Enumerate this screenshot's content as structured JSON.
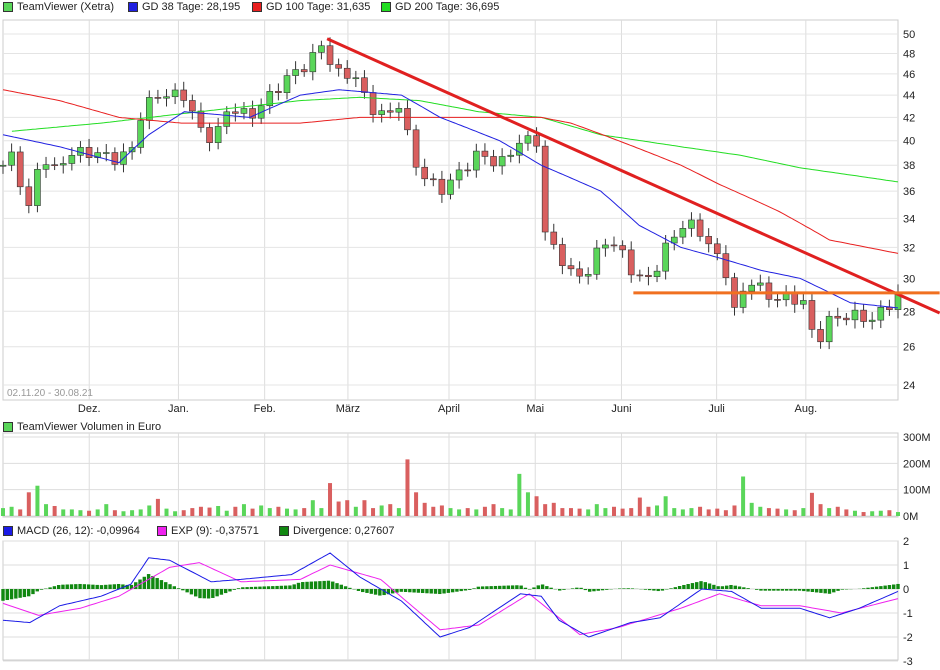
{
  "legend": {
    "title": "TeamViewer (Xetra)",
    "gd38": "GD 38 Tage: 28,195",
    "gd100": "GD 100 Tage: 31,635",
    "gd200": "GD 200 Tage: 36,695",
    "range": "02.11.20 - 30.08.21",
    "volume": "TeamViewer Volumen in Euro",
    "macd": "MACD (26, 12): -0,09964",
    "exp": "EXP (9): -0,37571",
    "div": "Divergence: 0,27607"
  },
  "colors": {
    "up": "#5ad65a",
    "down": "#d95f5f",
    "gd38": "#2020e0",
    "gd100": "#e82020",
    "gd200": "#22dd22",
    "trend": "#e02020",
    "support": "#f07020",
    "macd": "#1a1ae6",
    "exp": "#ee22ee",
    "div": "#118811"
  },
  "chart_data": [
    {
      "type": "candlestick",
      "title": "TeamViewer (Xetra)",
      "scale": "log",
      "ylim": [
        23,
        51
      ],
      "yticks": [
        "24",
        "26",
        "28",
        "30",
        "32",
        "34",
        "36",
        "38",
        "40",
        "42",
        "44",
        "46",
        "48",
        "50"
      ],
      "months": [
        {
          "label": "Dez.",
          "day": 29
        },
        {
          "label": "Jan.",
          "day": 59
        },
        {
          "label": "Feb.",
          "day": 88
        },
        {
          "label": "März",
          "day": 116
        },
        {
          "label": "April",
          "day": 150
        },
        {
          "label": "Mai",
          "day": 179
        },
        {
          "label": "Juni",
          "day": 208
        },
        {
          "label": "Juli",
          "day": 240
        },
        {
          "label": "Aug.",
          "day": 270
        }
      ],
      "days_total": 301,
      "close": [
        [
          0,
          38
        ],
        [
          4,
          39
        ],
        [
          8,
          34
        ],
        [
          13,
          39
        ],
        [
          17,
          37.5
        ],
        [
          23,
          39
        ],
        [
          31,
          39
        ],
        [
          38,
          38.5
        ],
        [
          43,
          39
        ],
        [
          46,
          42
        ],
        [
          51,
          44
        ],
        [
          61,
          44
        ],
        [
          66,
          41
        ],
        [
          71,
          40
        ],
        [
          76,
          43
        ],
        [
          83,
          42
        ],
        [
          90,
          44
        ],
        [
          97,
          46
        ],
        [
          103,
          47
        ],
        [
          107,
          49
        ],
        [
          112,
          46
        ],
        [
          118,
          46
        ],
        [
          123,
          43
        ],
        [
          129,
          42
        ],
        [
          134,
          43.5
        ],
        [
          137,
          39
        ],
        [
          140,
          37.5
        ],
        [
          147,
          36
        ],
        [
          154,
          37.5
        ],
        [
          160,
          39
        ],
        [
          167,
          38
        ],
        [
          174,
          40
        ],
        [
          180,
          40
        ],
        [
          182,
          33
        ],
        [
          187,
          31.5
        ],
        [
          192,
          30
        ],
        [
          197,
          30.5
        ],
        [
          202,
          32.5
        ],
        [
          207,
          32
        ],
        [
          213,
          30
        ],
        [
          218,
          30
        ],
        [
          223,
          32
        ],
        [
          228,
          33.5
        ],
        [
          233,
          33.5
        ],
        [
          238,
          32
        ],
        [
          243,
          30.5
        ],
        [
          246,
          28
        ],
        [
          251,
          30
        ],
        [
          258,
          28.8
        ],
        [
          265,
          28.8
        ],
        [
          270,
          28.5
        ],
        [
          273,
          26
        ],
        [
          278,
          27.5
        ],
        [
          285,
          27.8
        ],
        [
          292,
          27.5
        ],
        [
          297,
          28.2
        ],
        [
          301,
          29
        ]
      ],
      "gd38": [
        [
          0,
          40.5
        ],
        [
          19,
          39.5
        ],
        [
          39,
          38.2
        ],
        [
          49,
          40.5
        ],
        [
          61,
          42.5
        ],
        [
          83,
          42
        ],
        [
          100,
          44
        ],
        [
          113,
          44.5
        ],
        [
          134,
          44
        ],
        [
          147,
          42
        ],
        [
          167,
          40
        ],
        [
          181,
          38
        ],
        [
          201,
          36
        ],
        [
          214,
          33.5
        ],
        [
          228,
          32
        ],
        [
          241,
          31.3
        ],
        [
          255,
          30.5
        ],
        [
          268,
          30
        ],
        [
          285,
          28.5
        ],
        [
          301,
          28.2
        ]
      ],
      "gd100": [
        [
          0,
          44.5
        ],
        [
          19,
          43.5
        ],
        [
          39,
          42
        ],
        [
          60,
          41.5
        ],
        [
          83,
          41.5
        ],
        [
          100,
          41.5
        ],
        [
          120,
          42
        ],
        [
          140,
          42
        ],
        [
          160,
          42
        ],
        [
          181,
          42
        ],
        [
          191,
          41.5
        ],
        [
          207,
          40
        ],
        [
          228,
          38
        ],
        [
          241,
          36.5
        ],
        [
          261,
          34.5
        ],
        [
          278,
          32.5
        ],
        [
          301,
          31.6
        ]
      ],
      "gd200": [
        [
          3,
          40.8
        ],
        [
          33,
          41.5
        ],
        [
          66,
          42.5
        ],
        [
          100,
          43.5
        ],
        [
          120,
          43.8
        ],
        [
          140,
          43.5
        ],
        [
          160,
          42.5
        ],
        [
          181,
          42
        ],
        [
          201,
          40.5
        ],
        [
          228,
          39.5
        ],
        [
          248,
          38.8
        ],
        [
          268,
          37.8
        ],
        [
          301,
          36.7
        ]
      ],
      "trendline": [
        [
          109,
          49.5
        ],
        [
          315,
          27.9
        ]
      ],
      "support": [
        [
          212,
          29.1
        ],
        [
          315,
          29.1
        ]
      ]
    },
    {
      "type": "bar",
      "title": "TeamViewer Volumen in Euro",
      "ylim": [
        0,
        300
      ],
      "yticks": [
        "0M",
        "100M",
        "200M",
        "300M"
      ],
      "values": [
        30,
        35,
        25,
        90,
        115,
        45,
        38,
        25,
        25,
        22,
        20,
        25,
        45,
        22,
        18,
        22,
        25,
        40,
        65,
        28,
        18,
        22,
        30,
        35,
        32,
        38,
        20,
        35,
        45,
        28,
        40,
        30,
        35,
        28,
        25,
        30,
        60,
        30,
        125,
        55,
        60,
        35,
        60,
        30,
        40,
        45,
        30,
        215,
        90,
        50,
        35,
        40,
        30,
        25,
        30,
        25,
        35,
        45,
        30,
        25,
        160,
        90,
        75,
        45,
        50,
        30,
        30,
        28,
        25,
        45,
        30,
        35,
        28,
        30,
        70,
        35,
        40,
        75,
        30,
        25,
        30,
        35,
        25,
        28,
        22,
        40,
        150,
        50,
        35,
        30,
        28,
        25,
        22,
        30,
        88,
        45,
        30,
        35,
        25,
        20,
        15,
        18,
        20,
        22,
        15
      ]
    },
    {
      "type": "line",
      "title": "MACD",
      "ylim": [
        -3,
        2
      ],
      "yticks": [
        "-3",
        "-2",
        "-1",
        "0",
        "1",
        "2"
      ],
      "macd": [
        [
          0,
          -1.3
        ],
        [
          9,
          -1.4
        ],
        [
          19,
          -0.7
        ],
        [
          33,
          -0.3
        ],
        [
          43,
          0.2
        ],
        [
          49,
          1.3
        ],
        [
          56,
          1.2
        ],
        [
          70,
          0.3
        ],
        [
          80,
          0.4
        ],
        [
          97,
          0.6
        ],
        [
          110,
          1.5
        ],
        [
          120,
          0.5
        ],
        [
          134,
          -0.5
        ],
        [
          147,
          -2.0
        ],
        [
          157,
          -1.6
        ],
        [
          174,
          -0.2
        ],
        [
          181,
          -0.3
        ],
        [
          187,
          -1.3
        ],
        [
          197,
          -2.0
        ],
        [
          211,
          -1.4
        ],
        [
          221,
          -1.2
        ],
        [
          235,
          0
        ],
        [
          245,
          -0.1
        ],
        [
          255,
          -0.8
        ],
        [
          268,
          -0.8
        ],
        [
          278,
          -1.2
        ],
        [
          288,
          -0.8
        ],
        [
          301,
          -0.1
        ]
      ],
      "exp": [
        [
          0,
          -0.6
        ],
        [
          12,
          -1.1
        ],
        [
          26,
          -0.8
        ],
        [
          39,
          -0.3
        ],
        [
          56,
          0.9
        ],
        [
          66,
          1.1
        ],
        [
          80,
          0.3
        ],
        [
          100,
          0.4
        ],
        [
          110,
          1.0
        ],
        [
          127,
          0.4
        ],
        [
          147,
          -1.7
        ],
        [
          160,
          -1.5
        ],
        [
          177,
          -0.2
        ],
        [
          194,
          -1.9
        ],
        [
          207,
          -1.6
        ],
        [
          228,
          -0.8
        ],
        [
          241,
          -0.2
        ],
        [
          255,
          -0.7
        ],
        [
          268,
          -0.7
        ],
        [
          282,
          -1.0
        ],
        [
          301,
          -0.4
        ]
      ]
    }
  ]
}
